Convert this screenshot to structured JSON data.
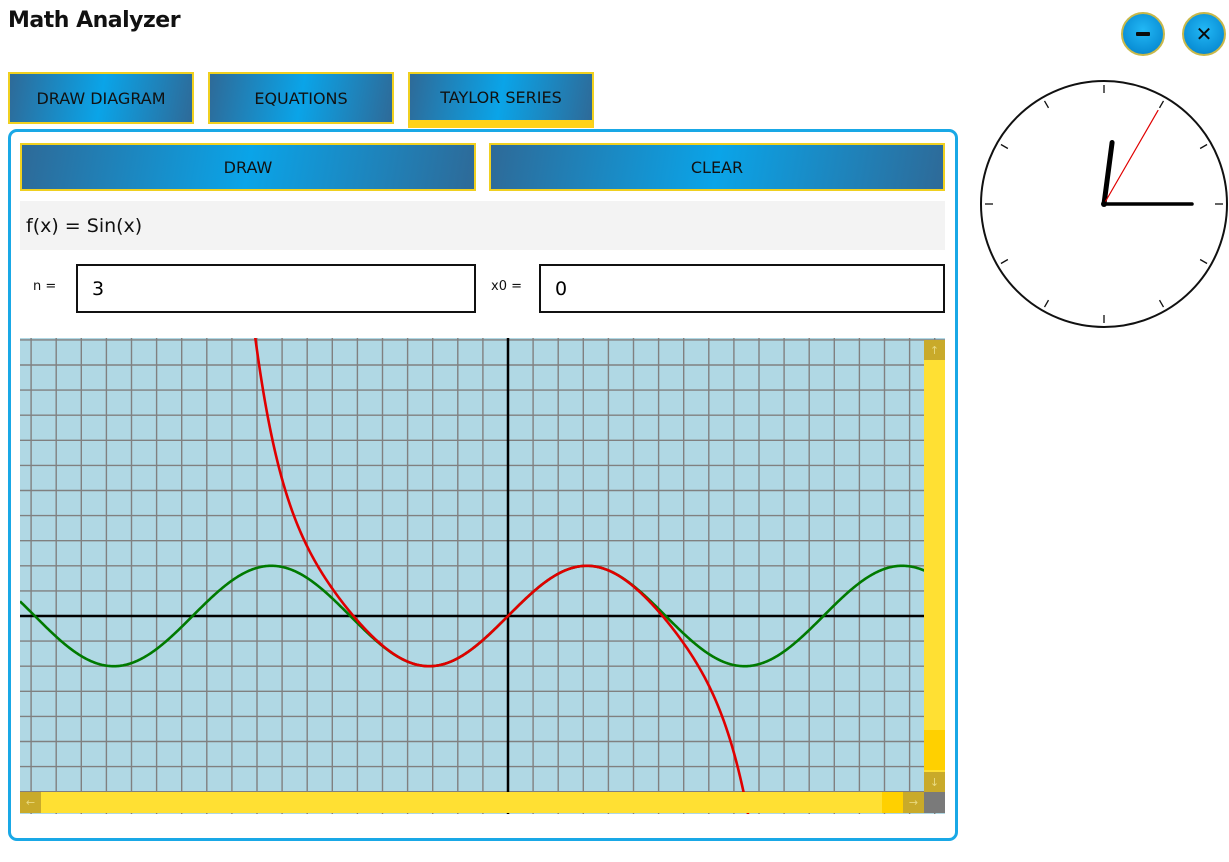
{
  "app": {
    "title": "Math Analyzer",
    "minimize_icon": "minimize-icon",
    "close_icon": "close-icon",
    "close_glyph": "✕"
  },
  "tabs": [
    {
      "label": "DRAW DIAGRAM",
      "active": false
    },
    {
      "label": "EQUATIONS",
      "active": false
    },
    {
      "label": "TAYLOR SERIES",
      "active": true
    }
  ],
  "taylor": {
    "draw_label": "DRAW",
    "clear_label": "CLEAR",
    "function_text": "f(x) = Sin(x)",
    "n_label": "n =",
    "n_value": "3",
    "x0_label": "x0 =",
    "x0_value": "0"
  },
  "chart_data": {
    "type": "line",
    "grid": true,
    "series": [
      {
        "function": "sin(x)",
        "color": "#007a00"
      },
      {
        "function": "x - x^3/6 + x^5/120 - x^7/5040",
        "color": "#e00000"
      }
    ]
  },
  "scrollbars": {
    "up_glyph": "↑",
    "down_glyph": "↓",
    "left_glyph": "←",
    "right_glyph": "→"
  },
  "clock": {
    "hour": 12,
    "minute": 15,
    "second": 5
  },
  "colors": {
    "accent": "#19a8e6",
    "tab_border": "#f0d020",
    "plot_background": "#b0d8e4",
    "grid": "#808080",
    "scrollbar": "#ffe033"
  }
}
